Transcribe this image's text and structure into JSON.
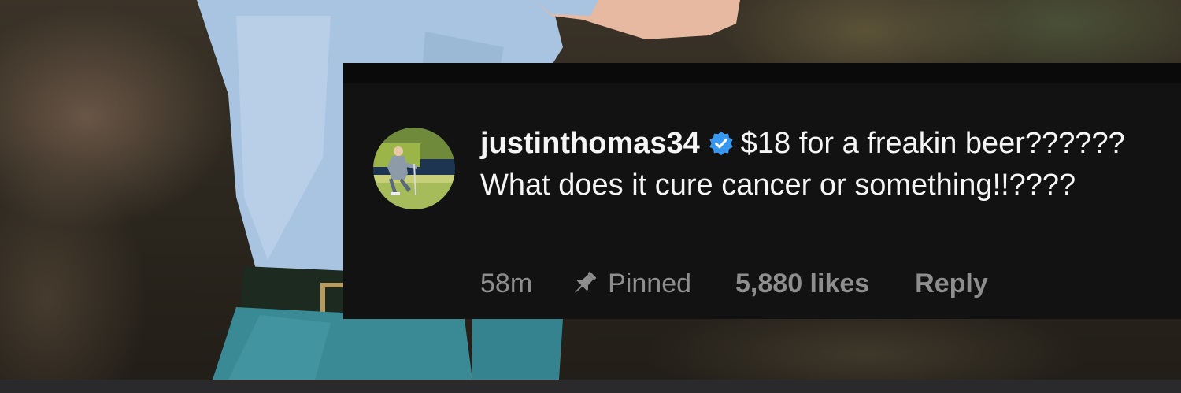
{
  "comment": {
    "username": "justinthomas34",
    "verified": true,
    "text": "$18 for a freakin beer?????? What does it cure cancer or something!!????",
    "time": "58m",
    "pinned_label": "Pinned",
    "likes": "5,880 likes",
    "reply_label": "Reply"
  },
  "icons": {
    "verified": "verified-badge-icon",
    "pin": "pin-icon"
  },
  "colors": {
    "card_background": "#121212",
    "text_primary": "#f5f5f5",
    "text_secondary": "#8e8e8e",
    "verified_blue": "#3897f0"
  }
}
